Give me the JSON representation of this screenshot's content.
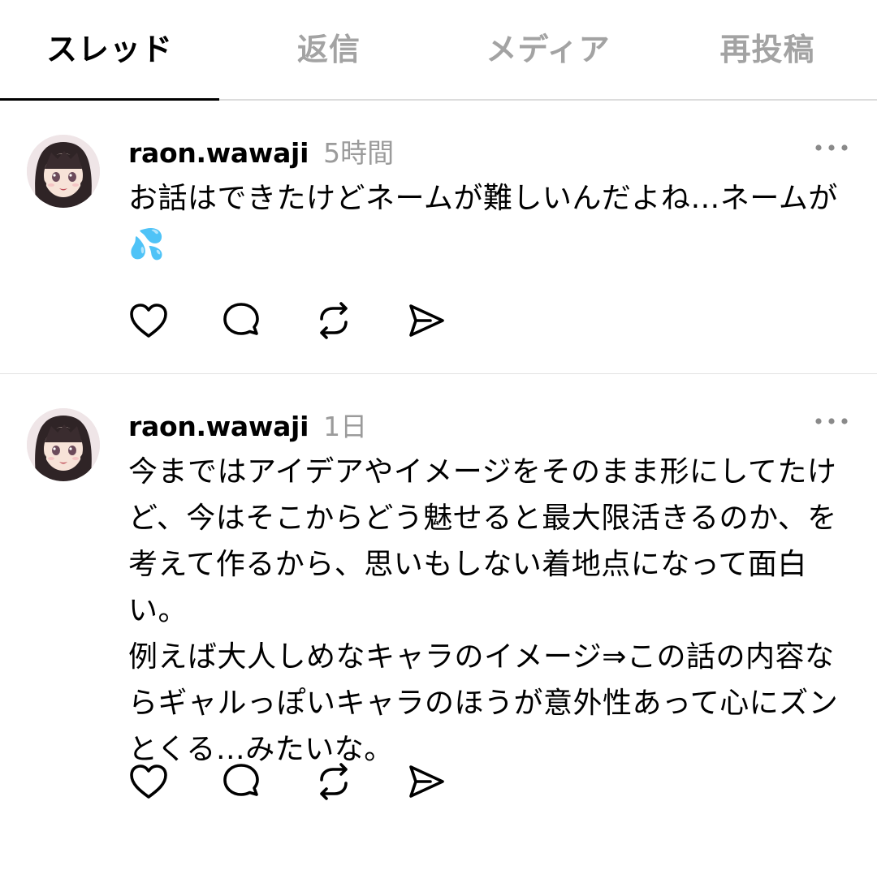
{
  "tabs": [
    {
      "label": "スレッド",
      "active": true
    },
    {
      "label": "返信",
      "active": false
    },
    {
      "label": "メディア",
      "active": false
    },
    {
      "label": "再投稿",
      "active": false
    }
  ],
  "posts": [
    {
      "username": "raon.wawaji",
      "time": "5時間",
      "text": "お話はできたけどネームが難しいんだよね…ネームが💦",
      "actions": [
        "heart-icon",
        "comment-icon",
        "repost-icon",
        "share-icon"
      ]
    },
    {
      "username": "raon.wawaji",
      "time": "1日",
      "text": "今まではアイデアやイメージをそのまま形にしてたけど、今はそこからどう魅せると最大限活きるのか、を考えて作るから、思いもしない着地点になって面白い。\n例えば大人しめなキャラのイメージ⇒この話の内容ならギャルっぽいキャラのほうが意外性あって心にズンとくる…みたいな。",
      "actions": [
        "heart-icon",
        "comment-icon",
        "repost-icon",
        "share-icon"
      ]
    }
  ],
  "colors": {
    "active_tab": "#000000",
    "inactive_tab": "#a3a3a3",
    "timestamp": "#9b9b9b",
    "divider": "#e2e2e2"
  }
}
